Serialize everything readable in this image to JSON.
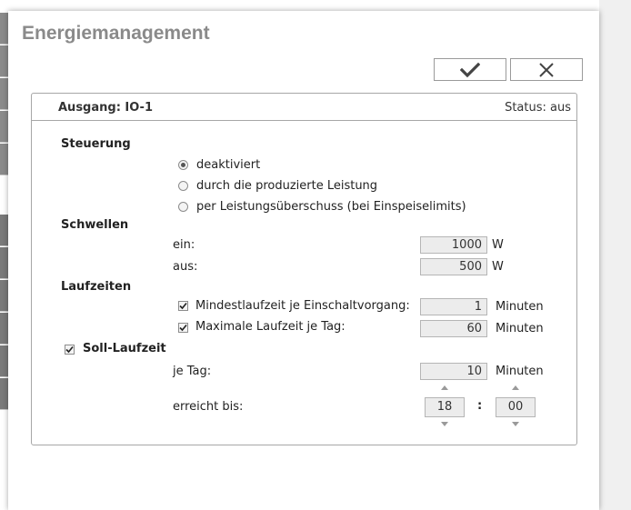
{
  "dialog": {
    "title": "Energiemanagement"
  },
  "toolbar": {
    "confirm_icon": "checkmark-icon",
    "cancel_icon": "close-icon"
  },
  "panel": {
    "output_label": "Ausgang: IO-1",
    "status_label": "Status: aus"
  },
  "steuerung": {
    "title": "Steuerung",
    "options": [
      {
        "label": "deaktiviert",
        "selected": true
      },
      {
        "label": "durch die produzierte Leistung",
        "selected": false
      },
      {
        "label": "per Leistungsüberschuss (bei Einspeiselimits)",
        "selected": false
      }
    ]
  },
  "schwellen": {
    "title": "Schwellen",
    "ein": {
      "label": "ein:",
      "value": "1000",
      "unit": "W"
    },
    "aus": {
      "label": "aus:",
      "value": "500",
      "unit": "W"
    }
  },
  "laufzeiten": {
    "title": "Laufzeiten",
    "min": {
      "label": "Mindestlaufzeit je Einschaltvorgang:",
      "value": "1",
      "unit": "Minuten",
      "checked": true
    },
    "max": {
      "label": "Maximale Laufzeit je Tag:",
      "value": "60",
      "unit": "Minuten",
      "checked": true
    }
  },
  "soll": {
    "title": "Soll-Laufzeit",
    "checked": true,
    "je_tag": {
      "label": "je Tag:",
      "value": "10",
      "unit": "Minuten"
    },
    "erreicht": {
      "label": "erreicht bis:",
      "hour": "18",
      "separator": ":",
      "minute": "00"
    }
  }
}
